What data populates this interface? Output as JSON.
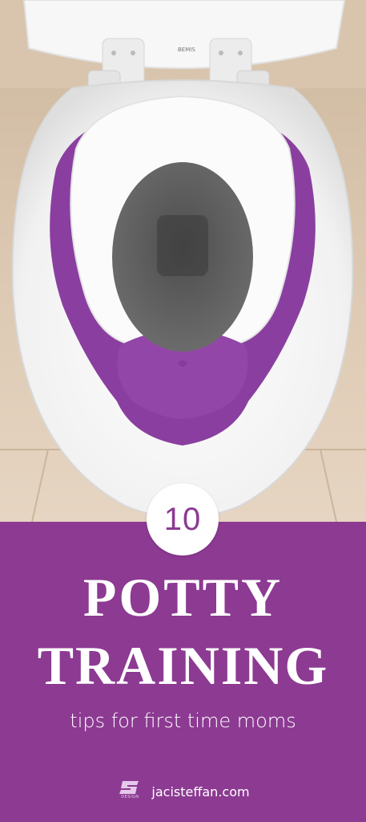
{
  "badge": {
    "number": "10"
  },
  "title": {
    "line1": "POTTY",
    "line2": "TRAINING"
  },
  "subtitle": "tips for first time moms",
  "footer": {
    "logo_top": "steffan",
    "logo_bottom": "DESIGN",
    "url": "jacisteffan.com"
  },
  "seat_brand": "BEMIS",
  "colors": {
    "accent": "#8c3a92",
    "seat_purple": "#8a3fa0",
    "text": "#ffffff"
  }
}
